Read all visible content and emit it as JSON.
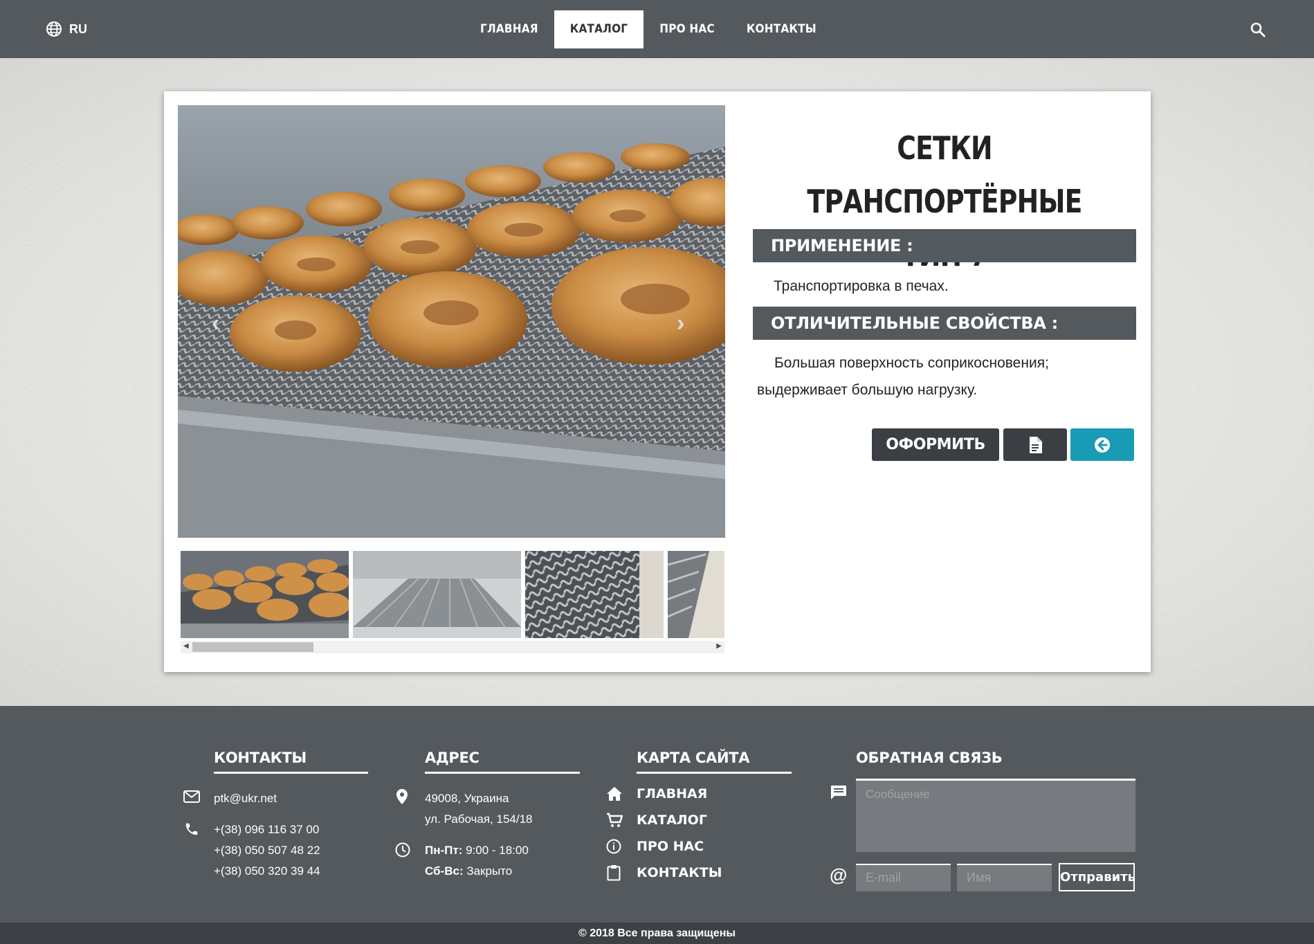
{
  "header": {
    "lang": "RU",
    "nav": [
      {
        "label": "ГЛАВНАЯ",
        "active": false
      },
      {
        "label": "КАТАЛОГ",
        "active": true
      },
      {
        "label": "ПРО НАС",
        "active": false
      },
      {
        "label": "КОНТАКТЫ",
        "active": false
      }
    ],
    "icons": {
      "lang": "globe-icon",
      "search": "search-icon"
    }
  },
  "product": {
    "title_line1": "СЕТКИ ТРАНСПОРТЁРНЫЕ",
    "title_line2": "ТИП 7",
    "application_heading": "ПРИМЕНЕНИЕ :",
    "application_text": "Транспортировка в печах.",
    "features_heading": "ОТЛИЧИТЕЛЬНЫЕ СВОЙСТВА :",
    "features_text_line1": "Большая поверхность соприкосновения;",
    "features_text_line2": "выдерживает большую нагрузку.",
    "order_label": "ОФОРМИТЬ",
    "doc_icon": "document-icon",
    "back_icon": "arrow-left-circle-icon",
    "accent_color": "#1a9bb5",
    "dark_color": "#3b3f44"
  },
  "gallery": {
    "prev": "‹",
    "next": "›",
    "thumbnail_count": 4
  },
  "footer": {
    "contacts": {
      "heading": "КОНТАКТЫ",
      "email": "ptk@ukr.net",
      "phones": [
        "+(38) 096 116 37 00",
        "+(38) 050 507 48 22",
        "+(38) 050 320 39 44"
      ]
    },
    "address": {
      "heading": "АДРЕС",
      "line1": "49008, Украина",
      "line2": "ул. Рабочая, 154/18",
      "hours1_label": "Пн-Пт:",
      "hours1_value": " 9:00 - 18:00",
      "hours2_label": "Сб-Вс:",
      "hours2_value": " Закрыто"
    },
    "sitemap": {
      "heading": "КАРТА САЙТА",
      "items": [
        "ГЛАВНАЯ",
        "КАТАЛОГ",
        "ПРО НАС",
        "КОНТАКТЫ"
      ]
    },
    "feedback": {
      "heading": "ОБРАТНАЯ СВЯЗЬ",
      "message_placeholder": "Сообщение",
      "email_placeholder": "E-mail",
      "name_placeholder": "Имя",
      "send_label": "Отправить"
    },
    "copyright": "© 2018 Все права защищены",
    "bg_color": "#54595e"
  }
}
